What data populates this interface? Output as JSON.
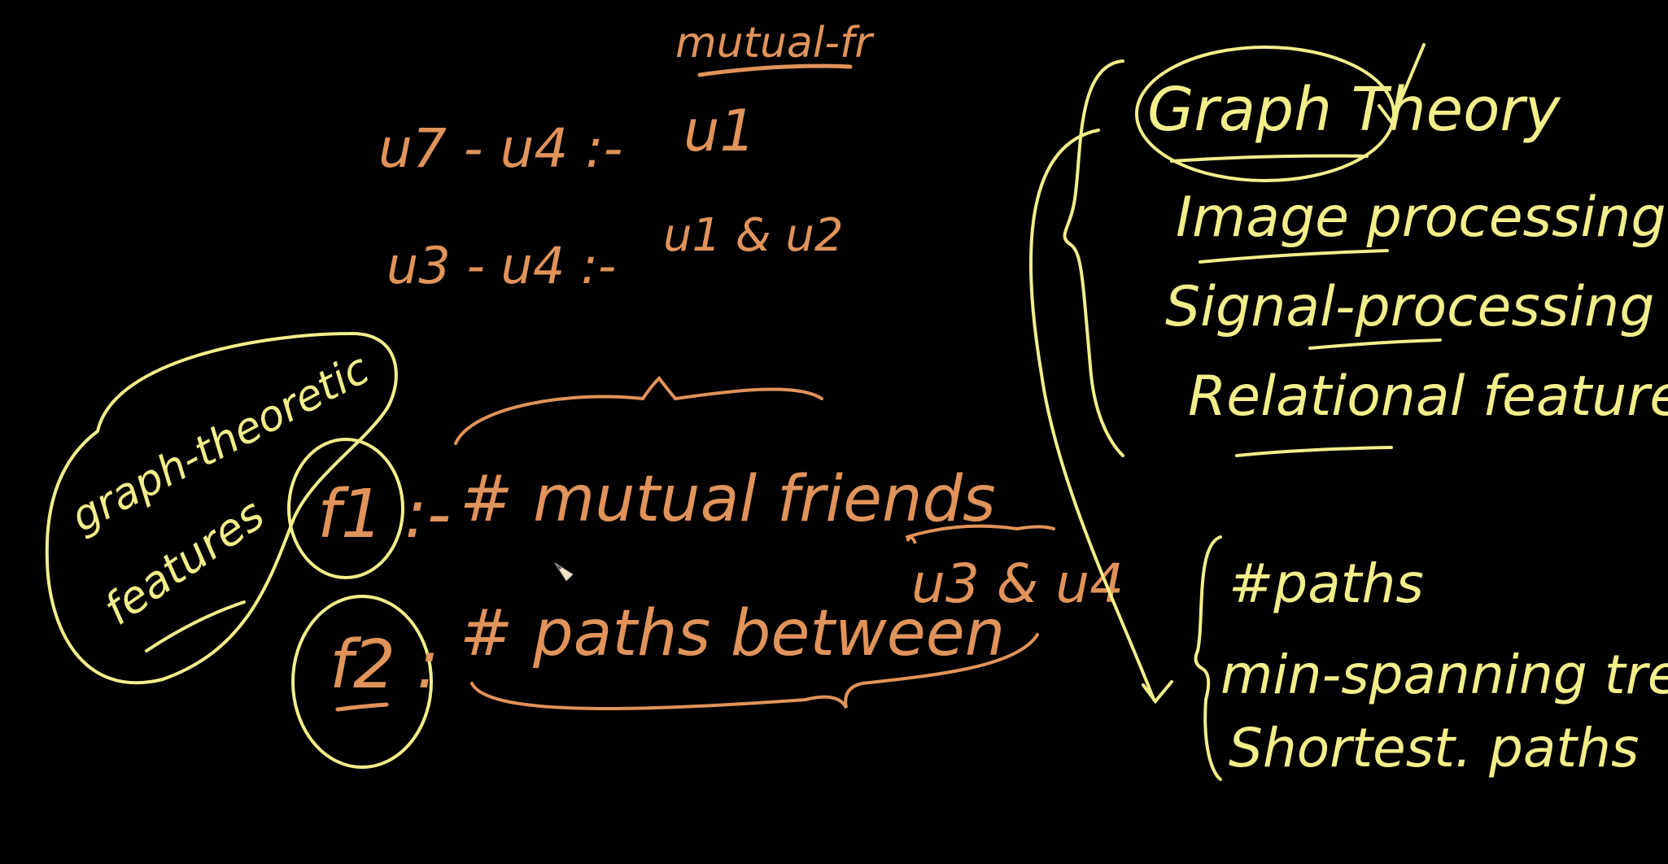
{
  "colors": {
    "background": "#000000",
    "orange_ink": "#e0935a",
    "yellow_ink": "#f2ee8a"
  },
  "left_notes": {
    "mutual_fr_heading": "mutual-fr",
    "line1_pair": "u7 - u4 :-",
    "line1_result": "u1",
    "line2_pair": "u3 - u4 :-",
    "line2_result": "u1 & u2",
    "group_label_line1": "graph-theoretic",
    "group_label_line2": "features",
    "f1_label": "f1 :-",
    "f1_text": "# mutual friends",
    "f2_label": "f2 :",
    "f2_text": "# paths  between",
    "f2_pair": "u3 & u4"
  },
  "right_notes": {
    "heading": "Graph Theory",
    "items": [
      "Image processing",
      "Signal-processing",
      "Relational features"
    ],
    "subitems": [
      "#paths",
      "min-spanning trees,",
      "Shortest. paths"
    ]
  },
  "cursor_icon": "pencil-cursor-icon"
}
